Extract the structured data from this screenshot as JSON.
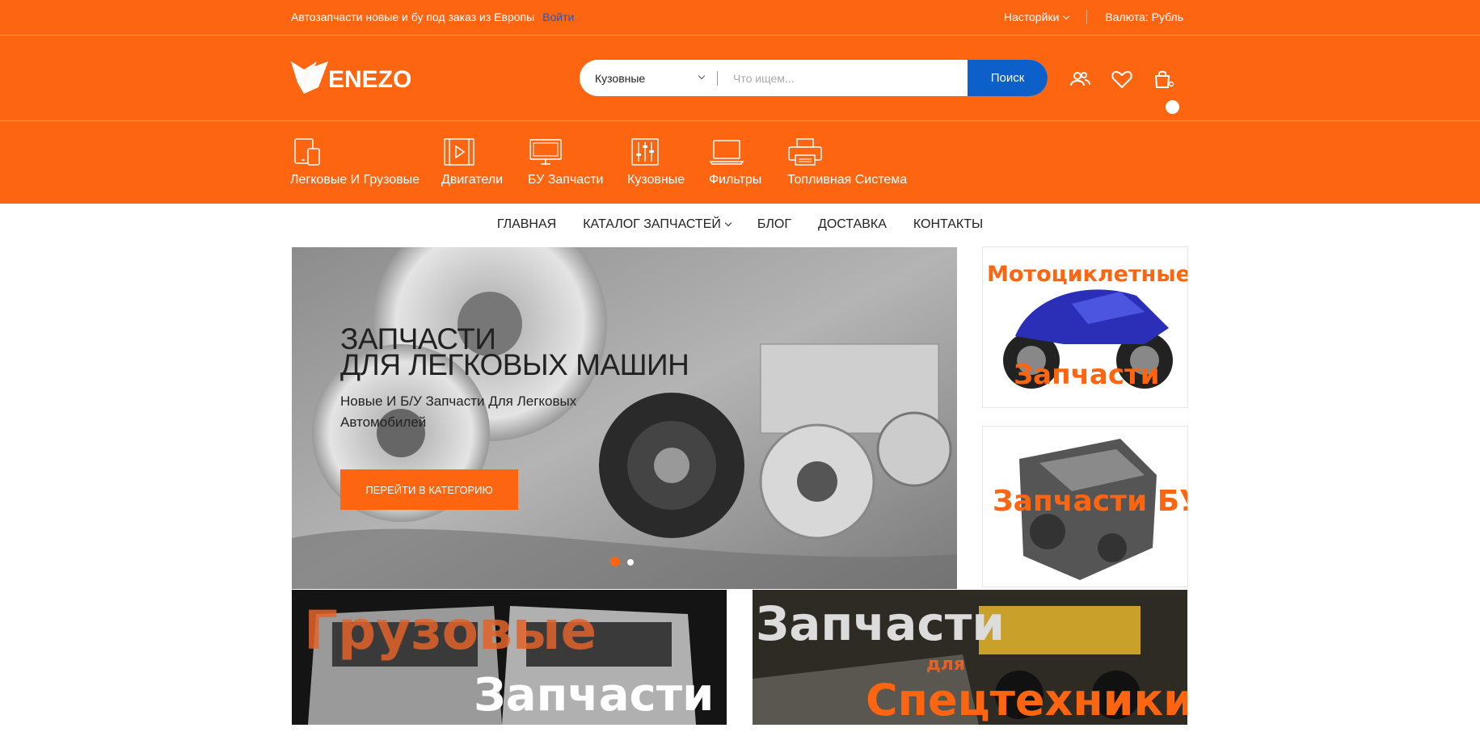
{
  "topbar": {
    "tagline": "Автозапчасти новые и бу под заказ из Европы",
    "login": "Войти",
    "settings": "Насторйки",
    "currency": "Валюта: Рубль"
  },
  "header": {
    "logo_text": "ENEZO",
    "search": {
      "category": "Кузовные",
      "placeholder": "Что ищем...",
      "button": "Поиск"
    },
    "icons": [
      "account-icon",
      "wishlist-icon",
      "cart-icon"
    ]
  },
  "categories": [
    {
      "label": "Легковые И Грузовые",
      "icon": "devices-icon"
    },
    {
      "label": "Двигатели",
      "icon": "film-icon"
    },
    {
      "label": "БУ Запчасти",
      "icon": "monitor-icon"
    },
    {
      "label": "Кузовные",
      "icon": "sliders-icon"
    },
    {
      "label": "Фильтры",
      "icon": "laptop-icon"
    },
    {
      "label": "Топливная Система",
      "icon": "printer-icon"
    }
  ],
  "nav": {
    "home": "ГЛАВНАЯ",
    "catalog": "КАТАЛОГ ЗАПЧАСТЕЙ",
    "blog": "БЛОГ",
    "delivery": "ДОСТАВКА",
    "contacts": "КОНТАКТЫ"
  },
  "hero": {
    "title_line1": "ЗАПЧАСТИ",
    "title_line2": "ДЛЯ ЛЕГКОВЫХ МАШИН",
    "subtitle": "Новые И Б/У Запчасти Для Легковых Автомобилей",
    "button": "ПЕРЕЙТИ В КАТЕГОРИЮ",
    "slides": 2,
    "active_slide": 1
  },
  "banners": {
    "moto": {
      "line1": "Мотоциклетные",
      "line2": "Запчасти"
    },
    "used": {
      "text": "Запчасти БУ"
    },
    "truck": {
      "line1": "Грузовые",
      "line2": "Запчасти"
    },
    "special": {
      "line1": "Запчасти",
      "line2": "для",
      "line3": "Спецтехники"
    }
  },
  "colors": {
    "brand_orange": "#fe6511",
    "search_blue": "#0d5fc9",
    "login_link": "#1f5bbf"
  }
}
